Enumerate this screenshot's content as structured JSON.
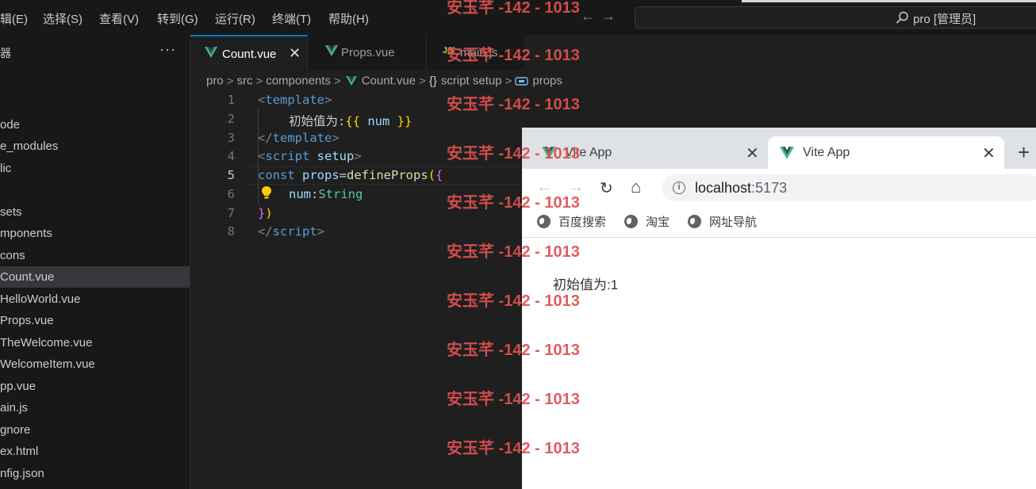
{
  "menubar": {
    "items": [
      "辑(E)",
      "选择(S)",
      "查看(V)",
      "转到(G)",
      "运行(R)",
      "终端(T)",
      "帮助(H)"
    ],
    "search_text": "pro [管理员]",
    "back_arrow": "←",
    "forward_arrow": "→"
  },
  "sidebar": {
    "title": "器",
    "more": "···",
    "items": [
      {
        "label": "ode"
      },
      {
        "label": "e_modules"
      },
      {
        "label": "lic"
      },
      {
        "label": "sets"
      },
      {
        "label": "mponents"
      },
      {
        "label": "cons"
      },
      {
        "label": "Count.vue",
        "selected": true
      },
      {
        "label": "HelloWorld.vue"
      },
      {
        "label": "Props.vue"
      },
      {
        "label": "TheWelcome.vue"
      },
      {
        "label": "WelcomeItem.vue"
      },
      {
        "label": "pp.vue"
      },
      {
        "label": "ain.js"
      },
      {
        "label": "gnore"
      },
      {
        "label": "ex.html"
      },
      {
        "label": "nfig.json"
      }
    ]
  },
  "tabs": [
    {
      "label": "Count.vue",
      "icon": "vue-icon",
      "active": true,
      "close": "✕"
    },
    {
      "label": "Props.vue",
      "icon": "vue-icon"
    },
    {
      "label": "main.js",
      "icon": "js-icon",
      "icon_text": "JS"
    }
  ],
  "breadcrumb": [
    "pro",
    "src",
    "components",
    "Count.vue",
    "script setup",
    "props"
  ],
  "breadcrumb_glyphs": {
    "braces": "{}",
    "sep": ">"
  },
  "editor": {
    "line_numbers": [
      "1",
      "2",
      "3",
      "4",
      "5",
      "6",
      "7",
      "8"
    ],
    "current_line": "5",
    "code": {
      "l1_open": "<",
      "l1_tag": "template",
      "l1_close": ">",
      "l2_text": "初始值为:",
      "l2_open": "{{ ",
      "l2_var": "num",
      "l2_close": " }}",
      "l3_open": "</",
      "l3_tag": "template",
      "l3_close": ">",
      "l4_open": "<",
      "l4_tag": "script",
      "l4_attr": " setup",
      "l4_close": ">",
      "l5_kw": "const ",
      "l5_var": "props",
      "l5_eq": "=",
      "l5_fn": "defineProps",
      "l5_p": "(",
      "l5_b": "{",
      "l6_key": "num",
      "l6_colon": ":",
      "l6_type": "String",
      "l7_b": "}",
      "l7_p": ")",
      "l8_open": "</",
      "l8_tag": "script",
      "l8_close": ">"
    }
  },
  "browser": {
    "tabs": [
      {
        "label": "Vite App",
        "close": "✕"
      },
      {
        "label": "Vite App",
        "close": "✕",
        "active": true
      }
    ],
    "new_tab": "+",
    "nav": {
      "back": "←",
      "forward": "→",
      "reload": "↻",
      "home": "⌂"
    },
    "address": {
      "host": "localhost",
      "port": ":5173",
      "info": "i"
    },
    "bookmarks": [
      "百度搜索",
      "淘宝",
      "网址导航"
    ],
    "page_text": "初始值为:1"
  },
  "watermark": "安玉芊 -142 - 1013",
  "colors": {
    "accent": "#0078d4",
    "vue_green": "#42b883",
    "watermark": "#e05050"
  }
}
